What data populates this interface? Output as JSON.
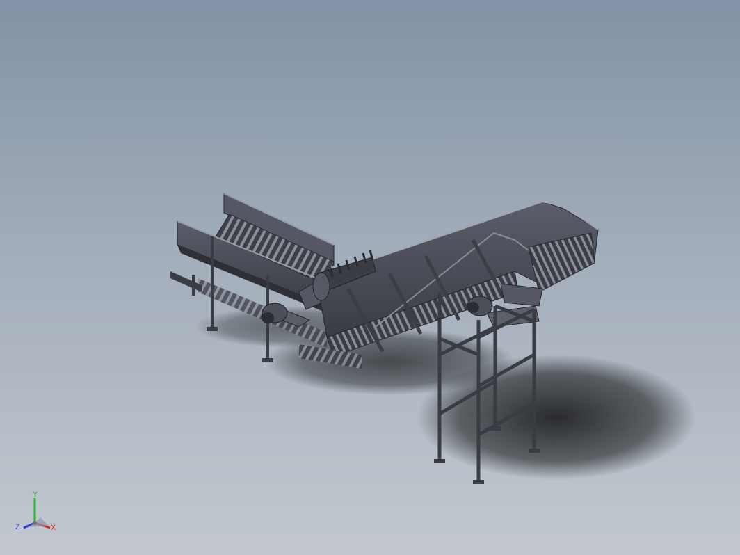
{
  "viewport": {
    "background_top": "#8392a6",
    "background_bottom": "#c3c8cf",
    "model_color": "#4a4c57"
  },
  "triad": {
    "x_label": "X",
    "y_label": "Y",
    "z_label": "Z",
    "x_color": "#d8262f",
    "y_color": "#2fae3a",
    "z_color": "#2b3fd6"
  }
}
